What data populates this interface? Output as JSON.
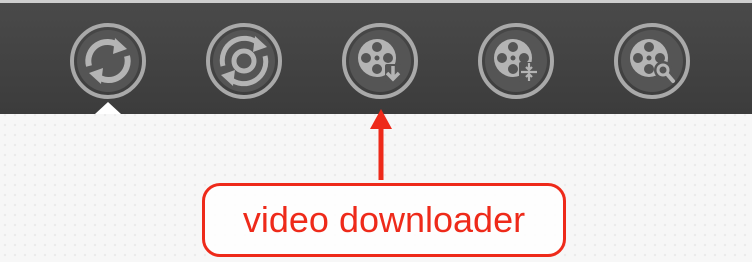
{
  "toolbar": {
    "buttons": [
      {
        "name": "convert",
        "icon": "circular-arrows-convert-icon"
      },
      {
        "name": "convert-disc",
        "icon": "rotate-disc-icon"
      },
      {
        "name": "video-downloader",
        "icon": "film-reel-download-icon"
      },
      {
        "name": "video-compressor",
        "icon": "film-reel-compress-icon"
      },
      {
        "name": "video-editor",
        "icon": "film-reel-wrench-icon"
      }
    ],
    "active_index": 0
  },
  "annotation": {
    "label": "video downloader",
    "color": "#ee2a1a"
  },
  "colors": {
    "toolbar_bg": "#404040",
    "icon_stroke": "#a9a9a9",
    "page_bg": "#f7f7f7"
  }
}
